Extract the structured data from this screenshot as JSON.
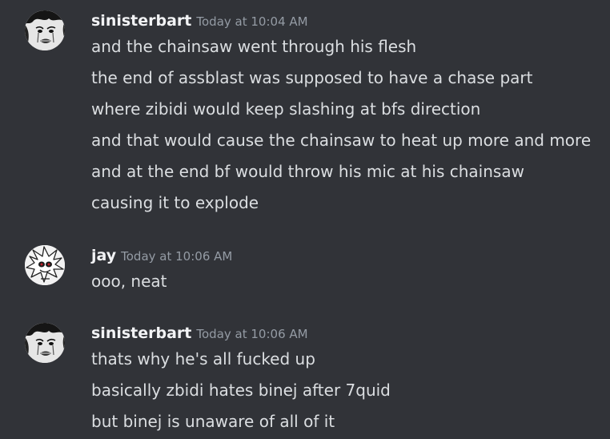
{
  "messages": [
    {
      "username": "sinisterbart",
      "timestamp": "Today at 10:04 AM",
      "avatar_icon": "sad-crying-face-icon",
      "lines": [
        "and the chainsaw went through his flesh",
        "the end of assblast was supposed to have a chase part",
        "where zibidi would keep slashing at bfs direction",
        "and that would cause the chainsaw to heat up more and more",
        "and at the end bf would throw his mic at his chainsaw",
        "causing it to explode"
      ]
    },
    {
      "username": "jay",
      "timestamp": "Today at 10:06 AM",
      "avatar_icon": "white-hedgehog-character-icon",
      "lines": [
        "ooo, neat"
      ]
    },
    {
      "username": "sinisterbart",
      "timestamp": "Today at 10:06 AM",
      "avatar_icon": "sad-crying-face-icon",
      "lines": [
        "thats why he's all fucked up",
        "basically zbidi hates binej after 7quid",
        "but binej is unaware of all of it"
      ]
    }
  ],
  "colors": {
    "background": "#313338",
    "username": "#f2f3f5",
    "timestamp": "#949ba4",
    "text": "#dbdee1"
  }
}
